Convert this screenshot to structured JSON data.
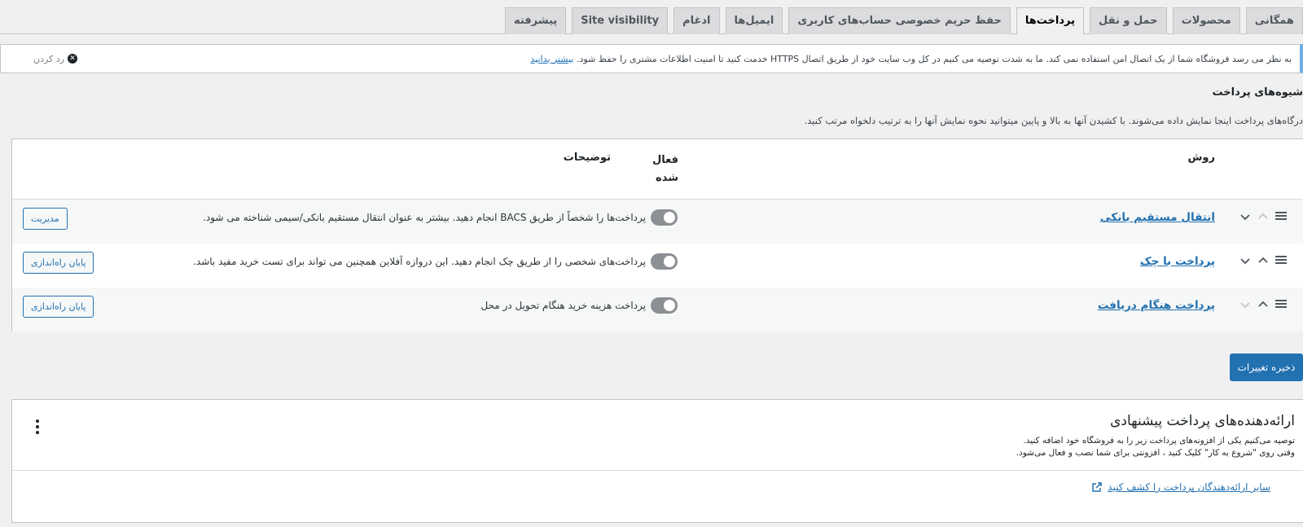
{
  "tabs": [
    {
      "label": "همگانی",
      "active": false
    },
    {
      "label": "محصولات",
      "active": false
    },
    {
      "label": "حمل و نقل",
      "active": false
    },
    {
      "label": "پرداخت‌ها",
      "active": true
    },
    {
      "label": "حفظ حریم خصوصی حساب‌های کاربری",
      "active": false
    },
    {
      "label": "ایمیل‌ها",
      "active": false
    },
    {
      "label": "ادغام",
      "active": false
    },
    {
      "label": "Site visibility",
      "active": false
    },
    {
      "label": "پیشرفته",
      "active": false
    }
  ],
  "notice": {
    "text": "به نظر می رسد فروشگاه شما از یک اتصال امن استفاده نمی کند. ما به شدت توصیه می کنیم در کل وب سایت خود از طریق اتصال HTTPS خدمت کنید تا امنیت اطلاعات مشتری را حفظ شود.",
    "link": "بیشتر بدانید",
    "dismiss": "رد کردن"
  },
  "section": {
    "title": "شیوه‌های پرداخت",
    "description": "درگاه‌های پرداخت اینجا نمایش داده می‌شوند. با کشیدن آنها به بالا و پایین میتوانید نحوه نمایش آنها را به ترتیب دلخواه مرتب کنید."
  },
  "table": {
    "col_method": "روش",
    "col_enabled_l1": "فعال",
    "col_enabled_l2": "شده",
    "col_desc": "توضیحات",
    "rows": [
      {
        "name": "انتقال مستقیم بانکی",
        "desc": "پرداخت‌ها را شخصاً از طریق BACS انجام دهید. بیشتر به عنوان انتقال مستقیم بانکی/سیمی شناخته می شود.",
        "button": "مدیریت",
        "enabled": false
      },
      {
        "name": "پرداخت با چک",
        "desc": "پرداخت‌های شخصی را از طریق چک انجام دهید. این دروازه آفلاین همچنین می تواند برای تست خرید مفید باشد.",
        "button": "پایان راه‌اندازی",
        "enabled": false
      },
      {
        "name": "پرداخت هنگام دریافت",
        "desc": "پرداخت هزینه خرید هنگام تحویل در محل",
        "button": "پایان راه‌اندازی",
        "enabled": false
      }
    ]
  },
  "save_label": "ذخیره تغییرات",
  "suggested": {
    "title": "ارائه‌دهنده‌های پرداخت پیشنهادی",
    "line1": "توصیه می‌کنیم یکی از افزونه‌های پرداخت زیر را به فروشگاه خود اضافه کنید.",
    "line2": "وقتی روی \"شروع به کار\" کلیک کنید ، افزونتی برای شما نصب و فعال می‌شود.",
    "discover": "سایر ارائه‌دهندگان پرداخت را کشف کنید"
  },
  "colors": {
    "accent": "#2271b1",
    "toggle_off": "#8c8f94",
    "notice_border": "#72aee6"
  }
}
